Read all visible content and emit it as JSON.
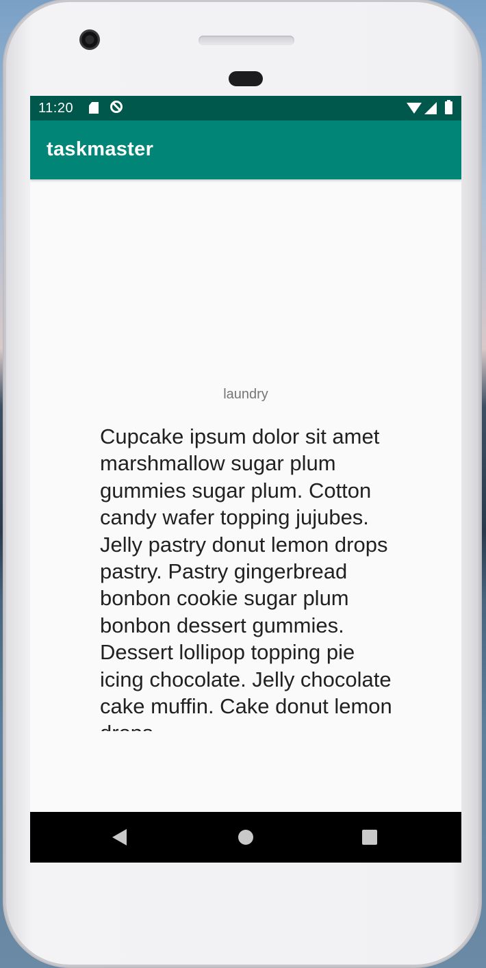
{
  "status_bar": {
    "time": "11:20",
    "icons": [
      "sd-card-icon",
      "sync-icon",
      "wifi-icon",
      "cell-signal-icon",
      "battery-icon"
    ]
  },
  "app_bar": {
    "title": "taskmaster"
  },
  "task": {
    "title": "laundry",
    "body": "Cupcake ipsum dolor sit amet marshmallow sugar plum gummies sugar plum. Cotton candy wafer topping jujubes. Jelly pastry donut lemon drops pastry. Pastry gingerbread bonbon cookie sugar plum bonbon dessert gummies. Dessert lollipop topping pie icing chocolate. Jelly chocolate cake muffin. Cake donut lemon drops"
  },
  "nav_bar": {
    "icons": [
      "back-icon",
      "home-icon",
      "recents-icon"
    ]
  },
  "colors": {
    "status_bar": "#00574b",
    "app_bar": "#008577",
    "background": "#fafafa",
    "nav_bar": "#000000"
  }
}
